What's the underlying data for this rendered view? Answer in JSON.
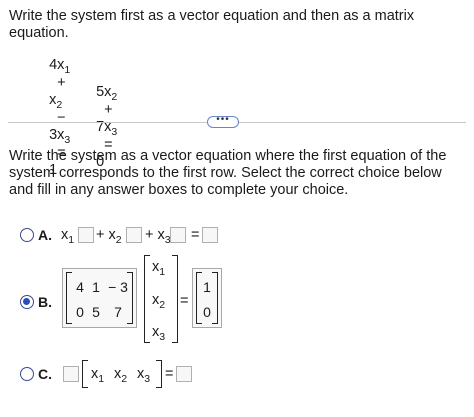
{
  "question": {
    "instruction": "Write the system first as a vector equation and then as a matrix equation.",
    "eq1": {
      "c1": "4x",
      "s1": "1",
      "op1": "+",
      "c2": "x",
      "s2": "2",
      "op2": "−",
      "c3": "3x",
      "s3": "3",
      "eq": "=",
      "rhs": "1"
    },
    "eq2": {
      "c1": "5x",
      "s1": "2",
      "op1": "+",
      "c2": "7x",
      "s2": "3",
      "eq": "=",
      "rhs": "0"
    },
    "more_button": "•••"
  },
  "part": {
    "prompt": "Write the system as a vector equation where the first equation of the system corresponds to the first row. Select the correct choice below and fill in any answer boxes to complete your choice."
  },
  "choices": {
    "a": {
      "label": "A.",
      "x1": "x",
      "s1": "1",
      "plus1": "+ x",
      "s2": "2",
      "plus2": "+ x",
      "s3": "3",
      "eq": "="
    },
    "b": {
      "label": "B.",
      "matrix": [
        [
          "4",
          "1",
          "− 3"
        ],
        [
          "0",
          "5",
          "7"
        ]
      ],
      "vars": [
        "x",
        "x",
        "x"
      ],
      "subs": [
        "1",
        "2",
        "3"
      ],
      "eq": "=",
      "rhs": [
        "1",
        "0"
      ],
      "selected": true
    },
    "c": {
      "label": "C.",
      "vars": [
        "x",
        "x",
        "x"
      ],
      "subs": [
        "1",
        "2",
        "3"
      ],
      "eq": "="
    }
  }
}
